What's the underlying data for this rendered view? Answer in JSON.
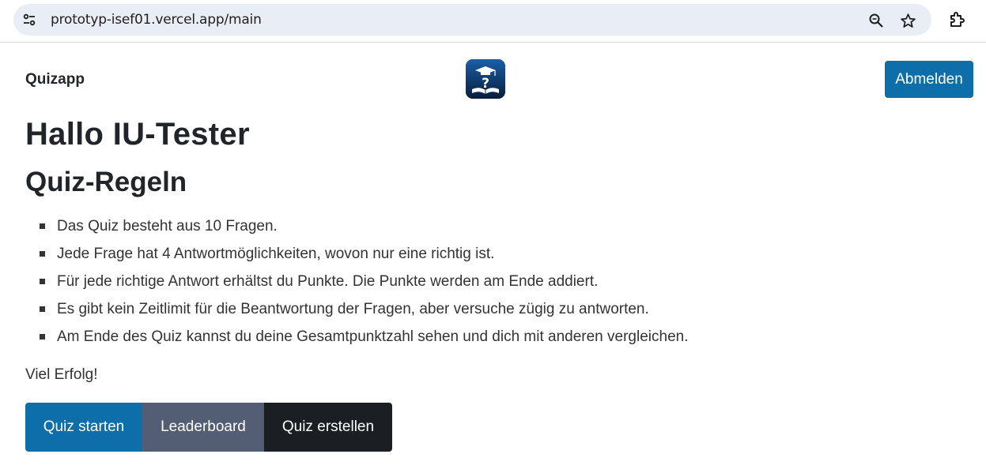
{
  "browser": {
    "url": "prototyp-isef01.vercel.app/main",
    "icons": [
      "site-info-icon",
      "zoom-icon",
      "star-icon",
      "extensions-icon"
    ]
  },
  "navbar": {
    "brand": "Quizapp",
    "logo_icon": "graduation-cap-question-book-icon",
    "logout_label": "Abmelden"
  },
  "main": {
    "greeting": "Hallo IU-Tester",
    "rules_title": "Quiz-Regeln",
    "rules": [
      "Das Quiz besteht aus 10 Fragen.",
      "Jede Frage hat 4 Antwortmöglichkeiten, wovon nur eine richtig ist.",
      "Für jede richtige Antwort erhältst du Punkte. Die Punkte werden am Ende addiert.",
      "Es gibt kein Zeitlimit für die Beantwortung der Fragen, aber versuche zügig zu antworten.",
      "Am Ende des Quiz kannst du deine Gesamtpunktzahl sehen und dich mit anderen vergleichen."
    ],
    "closing": "Viel Erfolg!",
    "buttons": {
      "start": "Quiz starten",
      "leaderboard": "Leaderboard",
      "create": "Quiz erstellen"
    }
  },
  "colors": {
    "primary": "#0d6eaa",
    "secondary": "#535d73",
    "dark": "#1b1f24",
    "text": "#212529"
  }
}
